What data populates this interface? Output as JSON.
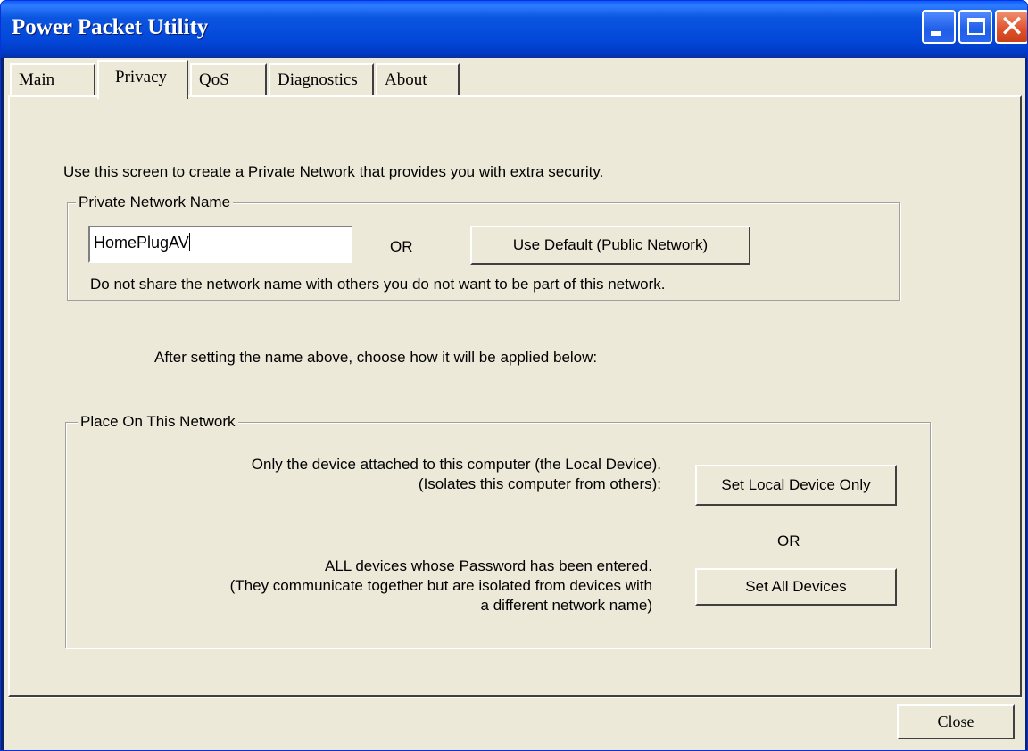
{
  "window": {
    "title": "Power Packet Utility"
  },
  "tabs": [
    {
      "label": "Main"
    },
    {
      "label": "Privacy",
      "active": true
    },
    {
      "label": "QoS"
    },
    {
      "label": "Diagnostics"
    },
    {
      "label": "About"
    }
  ],
  "privacy": {
    "intro": "Use this screen to create a Private Network that provides you with extra security.",
    "network_group": {
      "legend": "Private Network Name",
      "name_value": "HomePlugAV",
      "or_label": "OR",
      "default_button": "Use Default (Public Network)",
      "warning": "Do not share the network name with others you do not want to be part of this network."
    },
    "instruction": "After setting the name above, choose how it will be applied below:",
    "place_group": {
      "legend": "Place On This Network",
      "local_desc_line1": "Only the device attached to this computer (the Local Device).",
      "local_desc_line2": "(Isolates this computer from others):",
      "local_button": "Set Local Device Only",
      "or_label": "OR",
      "all_desc_line1": "ALL devices whose Password has been entered.",
      "all_desc_line2": "(They communicate together but are isolated from devices with",
      "all_desc_line3": "a different network name)",
      "all_button": "Set All Devices"
    }
  },
  "footer": {
    "close_button": "Close"
  },
  "icons": {
    "minimize": "minimize-icon",
    "maximize": "maximize-icon",
    "close": "close-icon"
  }
}
